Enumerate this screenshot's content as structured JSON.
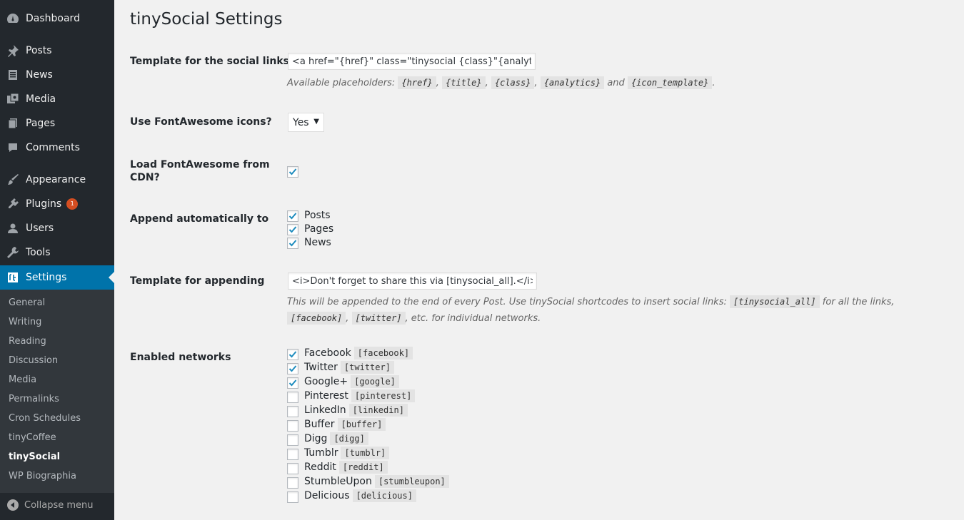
{
  "sidebar": {
    "items": [
      {
        "label": "Dashboard",
        "icon": "dashboard-icon"
      },
      {
        "label": "Posts",
        "icon": "pin-icon"
      },
      {
        "label": "News",
        "icon": "news-icon"
      },
      {
        "label": "Media",
        "icon": "media-icon"
      },
      {
        "label": "Pages",
        "icon": "pages-icon"
      },
      {
        "label": "Comments",
        "icon": "comments-icon"
      },
      {
        "label": "Appearance",
        "icon": "brush-icon"
      },
      {
        "label": "Plugins",
        "icon": "plugin-icon",
        "badge": "1"
      },
      {
        "label": "Users",
        "icon": "users-icon"
      },
      {
        "label": "Tools",
        "icon": "wrench-icon"
      },
      {
        "label": "Settings",
        "icon": "settings-icon",
        "current": true
      }
    ],
    "submenu": [
      "General",
      "Writing",
      "Reading",
      "Discussion",
      "Media",
      "Permalinks",
      "Cron Schedules",
      "tinyCoffee",
      "tinySocial",
      "WP Biographia"
    ],
    "submenu_current": "tinySocial",
    "collapse_label": "Collapse menu"
  },
  "page": {
    "title": "tinySocial Settings",
    "template_label": "Template for the social links",
    "template_value": "<a href=\"{href}\" class=\"tinysocial {class}\"{analytics}>",
    "placeholders_intro": "Available placeholders:",
    "placeholders": [
      "{href}",
      "{title}",
      "{class}",
      "{analytics}",
      "{icon_template}"
    ],
    "placeholders_and": "and",
    "fontawesome_label": "Use FontAwesome icons?",
    "fontawesome_value": "Yes",
    "cdn_label": "Load FontAwesome from CDN?",
    "cdn_checked": true,
    "append_label": "Append automatically to",
    "append_options": [
      {
        "label": "Posts",
        "checked": true
      },
      {
        "label": "Pages",
        "checked": true
      },
      {
        "label": "News",
        "checked": true
      }
    ],
    "append_template_label": "Template for appending",
    "append_template_value": "<i>Don't forget to share this via [tinysocial_all].</i>",
    "append_desc_1": "This will be appended to the end of every Post. Use tinySocial shortcodes to insert social links:",
    "append_code_all": "[tinysocial_all]",
    "append_desc_2": "for all the links,",
    "append_code_fb": "[facebook]",
    "append_code_tw": "[twitter]",
    "append_desc_3": ", etc. for individual networks.",
    "networks_label": "Enabled networks",
    "networks": [
      {
        "label": "Facebook",
        "code": "[facebook]",
        "checked": true
      },
      {
        "label": "Twitter",
        "code": "[twitter]",
        "checked": true
      },
      {
        "label": "Google+",
        "code": "[google]",
        "checked": true
      },
      {
        "label": "Pinterest",
        "code": "[pinterest]",
        "checked": false
      },
      {
        "label": "LinkedIn",
        "code": "[linkedin]",
        "checked": false
      },
      {
        "label": "Buffer",
        "code": "[buffer]",
        "checked": false
      },
      {
        "label": "Digg",
        "code": "[digg]",
        "checked": false
      },
      {
        "label": "Tumblr",
        "code": "[tumblr]",
        "checked": false
      },
      {
        "label": "Reddit",
        "code": "[reddit]",
        "checked": false
      },
      {
        "label": "StumbleUpon",
        "code": "[stumbleupon]",
        "checked": false
      },
      {
        "label": "Delicious",
        "code": "[delicious]",
        "checked": false
      }
    ]
  },
  "colors": {
    "accent": "#0073aa",
    "sidebar": "#23282d",
    "submenu": "#32373c",
    "badge": "#d54e21"
  }
}
